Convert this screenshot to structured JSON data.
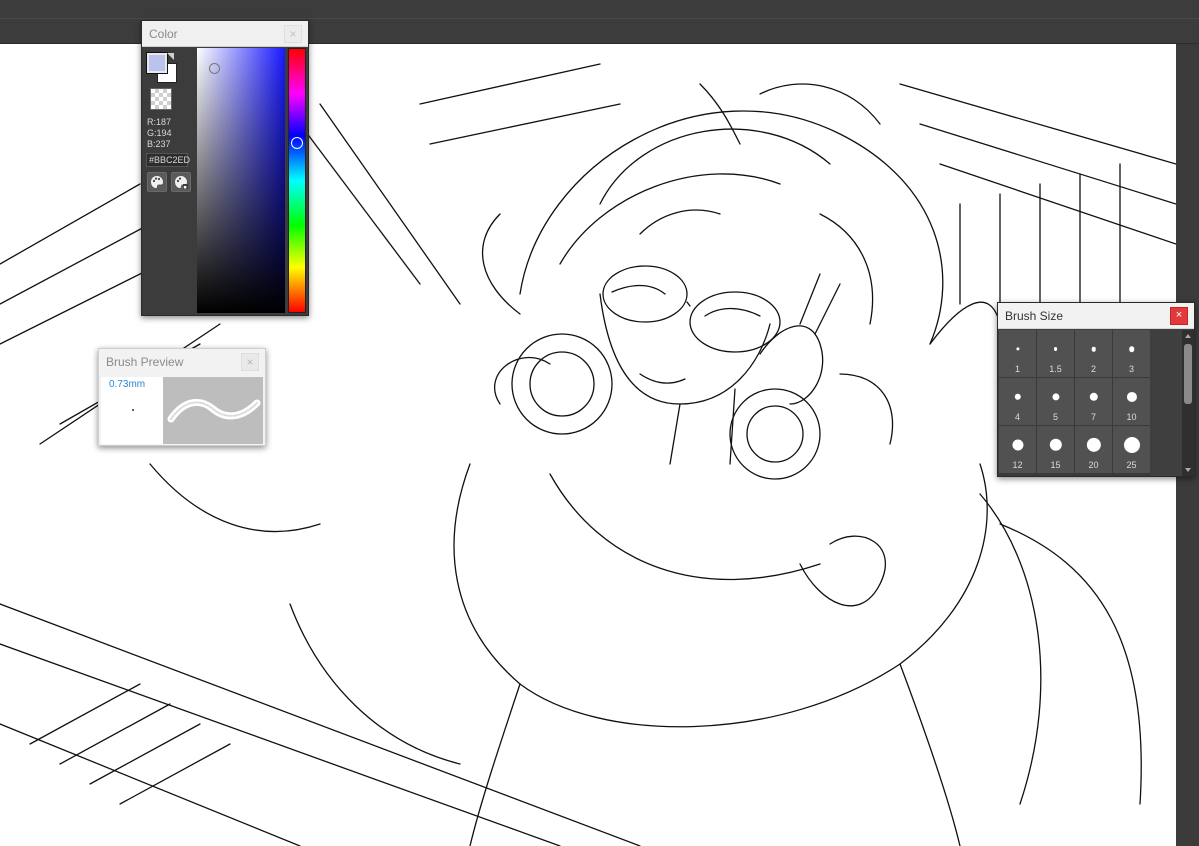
{
  "color_panel": {
    "title": "Color",
    "close_icon": "×",
    "rgb": {
      "r": "R:187",
      "g": "G:194",
      "b": "B:237"
    },
    "hex": "#BBC2ED",
    "current_color": "#BBC2ED",
    "hue_color": "#1a1aff",
    "buttons": [
      "palette-icon",
      "palette-add-icon"
    ]
  },
  "brush_preview": {
    "title": "Brush Preview",
    "close_icon": "×",
    "size": "0.73mm"
  },
  "brush_size": {
    "title": "Brush Size",
    "close_icon": "×",
    "sizes": [
      {
        "label": "1",
        "value": 1
      },
      {
        "label": "1.5",
        "value": 1.5
      },
      {
        "label": "2",
        "value": 2
      },
      {
        "label": "3",
        "value": 3
      },
      {
        "label": "4",
        "value": 4
      },
      {
        "label": "5",
        "value": 5
      },
      {
        "label": "7",
        "value": 7
      },
      {
        "label": "10",
        "value": 10
      },
      {
        "label": "12",
        "value": 12
      },
      {
        "label": "15",
        "value": 15
      },
      {
        "label": "20",
        "value": 20
      },
      {
        "label": "25",
        "value": 25
      }
    ]
  }
}
